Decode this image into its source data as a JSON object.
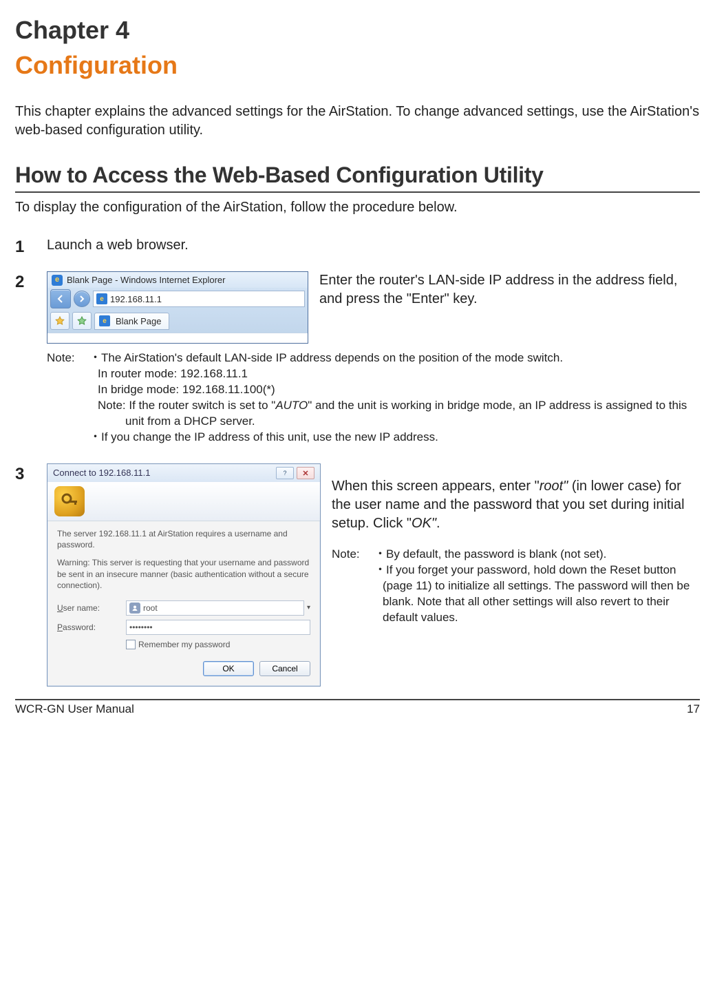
{
  "chapter": {
    "title": "Chapter 4",
    "subtitle": "Configuration"
  },
  "intro": "This chapter explains the advanced settings for the AirStation. To change advanced settings, use the AirStation's web-based configuration utility.",
  "section": {
    "heading": "How to Access the Web-Based Configuration Utility",
    "intro": "To display the configuration of the AirStation, follow the procedure below."
  },
  "steps": {
    "1": {
      "num": "1",
      "text": "Launch a web browser."
    },
    "2": {
      "num": "2",
      "browser": {
        "title": "Blank Page - Windows Internet Explorer",
        "address": "192.168.11.1",
        "tab": "Blank Page"
      },
      "text": "Enter the router's LAN-side IP address in the address field, and press the \"Enter\" key.",
      "note_label": "Note:",
      "note": {
        "l1": "・The AirStation's default LAN-side IP address depends on the position of the mode switch.",
        "l2": "In router mode:  192.168.11.1",
        "l3": "In bridge mode:  192.168.11.100(*)",
        "l4_pre": "Note:   If the router switch is set to \"",
        "l4_auto": "AUTO",
        "l4_post": "\" and the unit is working in bridge mode, an IP address is assigned to this unit from a DHCP server.",
        "l5": "・If you change the IP address of this unit, use the new IP address."
      }
    },
    "3": {
      "num": "3",
      "dialog": {
        "title": "Connect to 192.168.11.1",
        "banner_blank": "",
        "server_msg": "The server 192.168.11.1 at AirStation requires a username and password.",
        "warning": "Warning: This server is requesting that your username and password be sent in an insecure manner (basic authentication without a secure connection).",
        "username_label_pre": "U",
        "username_label_post": "ser name:",
        "password_label_pre": "P",
        "password_label_post": "assword:",
        "username_value": "root",
        "password_value": "••••••••",
        "remember": "Remember my password",
        "ok": "OK",
        "cancel": "Cancel"
      },
      "right": {
        "p1_a": "When this screen appears, enter \"",
        "p1_root": "root\"",
        "p1_b": " (in lower case) for the user name and the password that you set during initial setup. Click \"",
        "p1_ok": "OK\"",
        "p1_c": ".",
        "note_label": "Note:",
        "n1": "・By default, the password is blank (not set).",
        "n2": "・If you forget your password, hold down the Reset button (page 11) to initialize all settings. The password will then be blank. Note that all other settings will also revert to their default values."
      }
    }
  },
  "footer": {
    "left": "WCR-GN User Manual",
    "right": "17"
  }
}
